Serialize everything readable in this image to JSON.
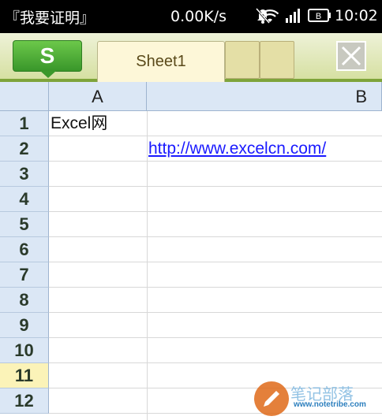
{
  "status_bar": {
    "title": "『我要证明』",
    "speed": "0.00K/s",
    "battery": "B",
    "time": "10:02"
  },
  "toolbar": {
    "s_label": "S",
    "active_tab": "Sheet1"
  },
  "columns": [
    "A",
    "B"
  ],
  "rows": [
    "1",
    "2",
    "3",
    "4",
    "5",
    "6",
    "7",
    "8",
    "9",
    "10",
    "11",
    "12"
  ],
  "selected_row": "11",
  "cells": {
    "A1": "Excel网",
    "B2": "http://www.excelcn.com/"
  },
  "watermark": {
    "text1": "笔记部落",
    "text2": "www.notetribe.com"
  }
}
